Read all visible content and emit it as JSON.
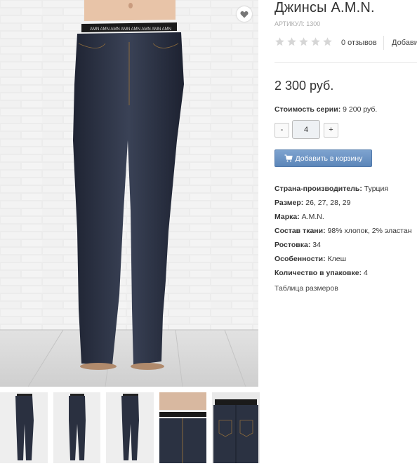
{
  "product": {
    "title": "Джинсы A.M.N.",
    "sku": "АРТИКУЛ: 1300",
    "rating_stars": 5,
    "rating_value": 0,
    "reviews": "0 отзывов",
    "add_review": "Добави",
    "price": "2 300 руб."
  },
  "series": {
    "label": "Стоимость серии:",
    "value": "9 200 руб."
  },
  "quantity": {
    "minus": "-",
    "value": "4",
    "plus": "+"
  },
  "cart": {
    "label": "Добавить в корзину"
  },
  "specs": [
    {
      "label": "Страна-производитель:",
      "value": "Турция"
    },
    {
      "label": "Размер:",
      "value": "26, 27, 28, 29"
    },
    {
      "label": "Марка:",
      "value": "A.M.N."
    },
    {
      "label": "Состав ткани:",
      "value": "98% хлопок, 2% эластан"
    },
    {
      "label": "Ростовка:",
      "value": "34"
    },
    {
      "label": "Особенности:",
      "value": "Клеш"
    },
    {
      "label": "Количество в упаковке:",
      "value": "4"
    }
  ],
  "size_table": "Таблица размеров",
  "icons": {
    "favorite": "heart-icon",
    "cart": "cart-icon",
    "star": "star-icon"
  },
  "colors": {
    "denim": "#2b3140",
    "button": "#6a92c4",
    "star": "#d6d6d6"
  }
}
